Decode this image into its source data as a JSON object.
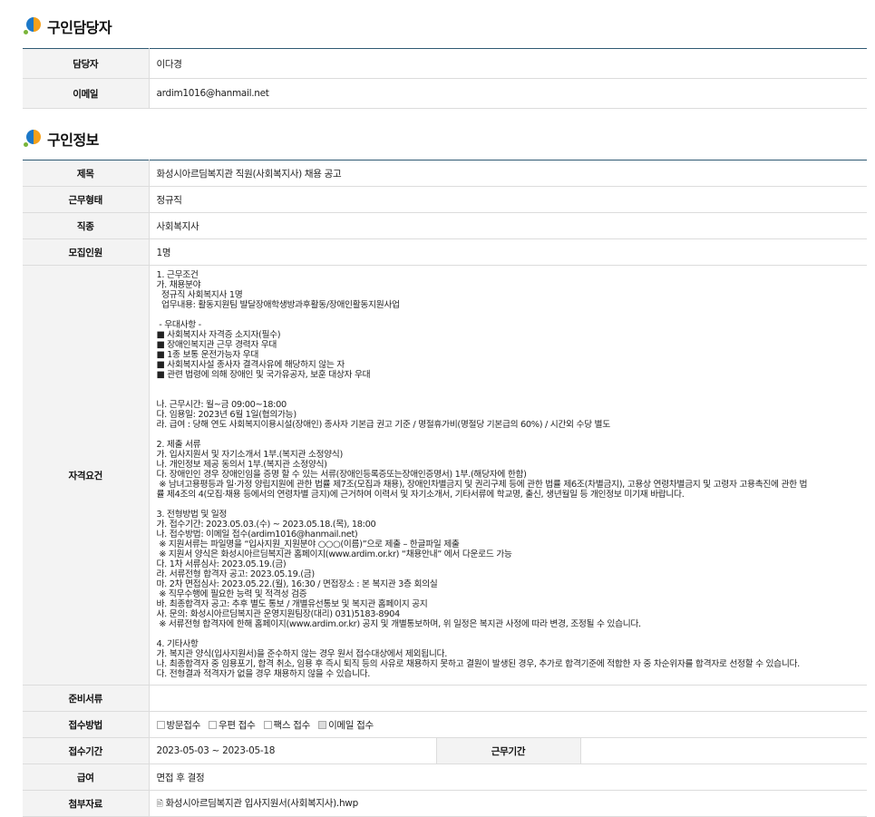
{
  "recruiter_section": {
    "title": "구인담당자",
    "rows": [
      {
        "label": "담당자",
        "value": "이다경"
      },
      {
        "label": "이메일",
        "value": "ardim1016@hanmail.net"
      }
    ]
  },
  "job_section": {
    "title": "구인정보",
    "rows": [
      {
        "label": "제목",
        "value": "화성시아르딤복지관 직원(사회복지사) 채용 공고"
      },
      {
        "label": "근무형태",
        "value": "정규직"
      },
      {
        "label": "직종",
        "value": "사회복지사"
      },
      {
        "label": "모집인원",
        "value": "1명"
      }
    ],
    "qualification_label": "자격요건",
    "qualification_lines": [
      "1. 근무조건",
      "가. 채용분야",
      "  정규직 사회복지사 1명",
      "  업무내용: 활동지원팀 발달장애학생방과후활동/장애인활동지원사업",
      "",
      " - 우대사항 -",
      "■ 사회복지사 자격증 소지자(필수)",
      "■ 장애인복지관 근무 경력자 우대",
      "■ 1종 보통 운전가능자 우대",
      "■ 사회복지사설 종사자 결격사유에 해당하지 않는 자",
      "■ 관련 법령에 의해 장애인 및 국가유공자, 보훈 대상자 우대",
      "",
      "",
      "나. 근무시간: 월~금 09:00~18:00",
      "다. 임용일: 2023년 6월 1일(협의가능)",
      "라. 급여 : 당해 연도 사회복지이용시설(장애인) 종사자 기본급 권고 기준 / 명절휴가비(명절당 기본급의 60%) / 시간외 수당 별도",
      "",
      "2. 제출 서류",
      "가. 입사지원서 및 자기소개서 1부.(복지관 소정양식)",
      "나. 개인정보 제공 동의서 1부.(복지관 소정양식)",
      "다. 장애인인 경우 장애인임을 증명 할 수 있는 서류(장애인등록증또는장애인증명서) 1부.(해당자에 한함)",
      " ※ 남녀고용평등과 일·가정 양립지원에 관한 법률 제7조(모집과 채용), 장애인차별금지 및 권리구제 등에 관한 법률 제6조(차별금지), 고용상 연령차별금지 및 고령자 고용촉진에 관한 법",
      "률 제4조의 4(모집·채용 등에서의 연령차별 금지)에 근거하여 이력서 및 자기소개서, 기타서류에 학교명, 출신, 생년월일 등 개인정보 미기재 바랍니다.",
      "",
      "3. 전형방법 및 일정",
      "가. 접수기간: 2023.05.03.(수) ~ 2023.05.18.(목), 18:00",
      "나. 접수방법: 이메일 접수(ardim1016@hanmail.net)",
      " ※ 지원서류는 파일명을 “입사지원_지원분야 ○○○(이름)”으로 제출 – 한글파일 제출",
      " ※ 지원서 양식은 화성시아르딤복지관 홈페이지(www.ardim.or.kr) “채용안내” 에서 다운로드 가능",
      "다. 1차 서류심사: 2023.05.19.(금)",
      "라. 서류전형 합격자 공고: 2023.05.19.(금)",
      "마. 2차 면접심사: 2023.05.22.(월), 16:30 / 면접장소 : 본 복지관 3층 회의실",
      " ※ 직무수행에 필요한 능력 및 적격성 검증",
      "바. 최종합격자 공고: 추후 별도 통보 / 개별유선통보 및 복지관 홈페이지 공지",
      "사. 문의: 화성시아르딤복지관 운영지원팀장(대리) 031)5183-8904",
      " ※ 서류전형 합격자에 한해 홈페이지(www.ardim.or.kr) 공지 및 개별통보하며, 위 일정은 복지관 사정에 따라 변경, 조정될 수 있습니다.",
      "",
      "4. 기타사항",
      "가. 복지관 양식(입사지원서)을 준수하지 않는 경우 원서 접수대상에서 제외됩니다.",
      "나. 최종합격자 중 임용포기, 합격 취소, 임용 후 즉시 퇴직 등의 사유로 채용하지 못하고 결원이 발생된 경우, 추가로 합격기준에 적합한 자 중 차순위자를 합격자로 선정할 수 있습니다.",
      "다. 전형결과 적격자가 없을 경우 채용하지 않을 수 있습니다."
    ],
    "documents_label": "준비서류",
    "documents_value": "",
    "method_label": "접수방법",
    "methods": [
      {
        "label": "방문접수",
        "checked": false
      },
      {
        "label": "우편 접수",
        "checked": false
      },
      {
        "label": "팩스 접수",
        "checked": false
      },
      {
        "label": "이메일 접수",
        "checked": true
      }
    ],
    "period_label": "접수기간",
    "period_value": "2023-05-03 ~ 2023-05-18",
    "work_period_label": "근무기간",
    "work_period_value": "",
    "salary_label": "급여",
    "salary_value": "면접 후 결정",
    "attachment_label": "첨부자료",
    "attachment_icon": "attachment-icon",
    "attachment_value": "화성시아르딤복지관 입사지원서(사회복지사).hwp"
  }
}
